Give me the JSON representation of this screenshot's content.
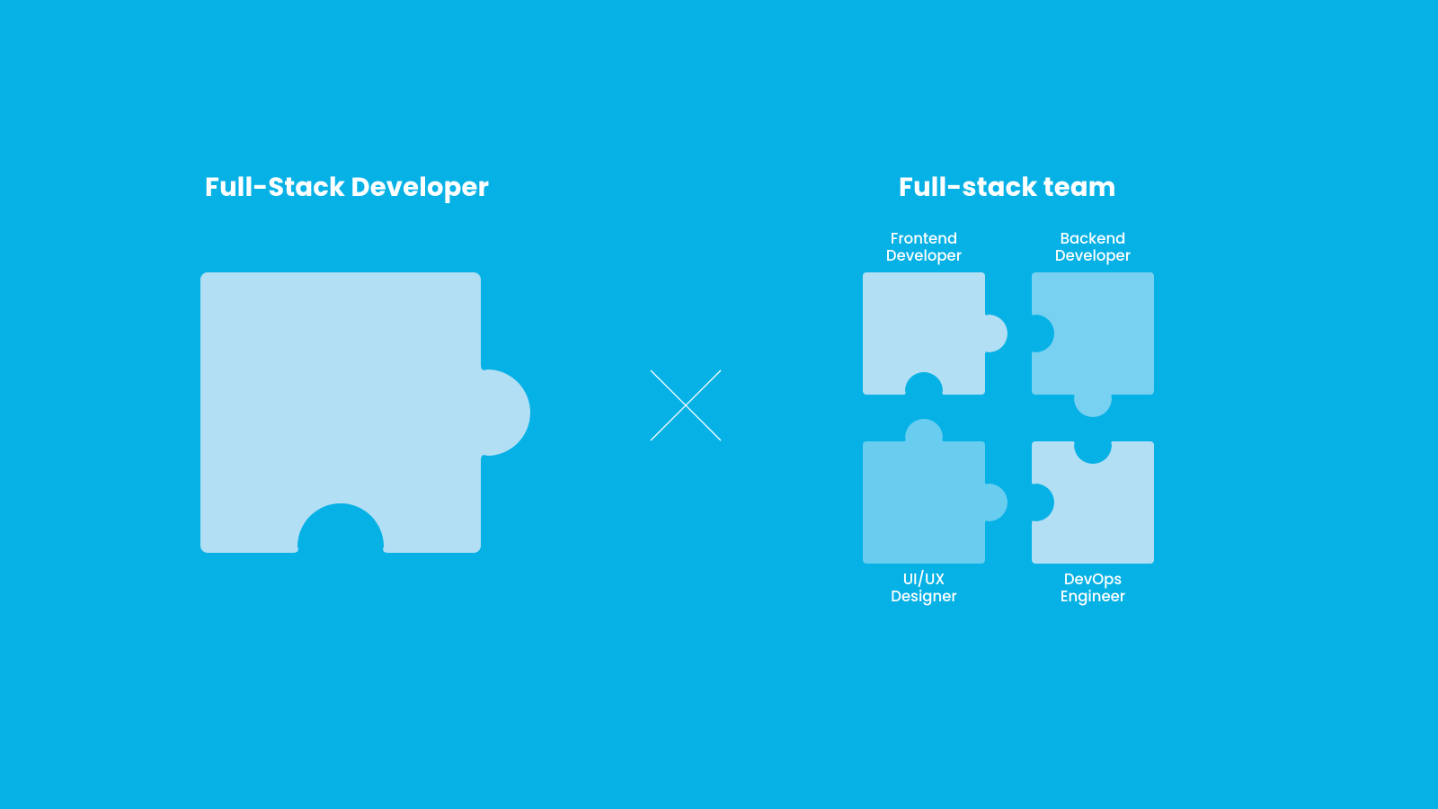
{
  "left": {
    "title": "Full-Stack Developer"
  },
  "right": {
    "title": "Full-stack team",
    "roles": {
      "tl": "Frontend\nDeveloper",
      "tr": "Backend\nDeveloper",
      "bl": "UI/UX\nDesigner",
      "br": "DevOps\nEngineer"
    }
  },
  "colors": {
    "bg": "#06b1e6",
    "light": "#b3dff4",
    "mid1": "#78d1f1",
    "mid2": "#69cdf0"
  }
}
